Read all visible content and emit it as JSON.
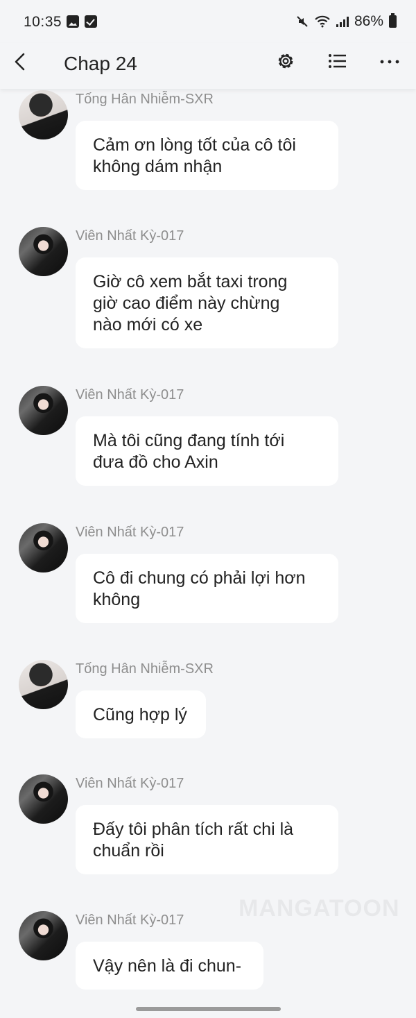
{
  "status_bar": {
    "time": "10:35",
    "battery": "86%",
    "icons": [
      "gallery-icon",
      "checkbox-icon",
      "mute-icon",
      "wifi-icon",
      "signal-icon",
      "battery-icon"
    ]
  },
  "header": {
    "title": "Chap 24",
    "icons": [
      "back-arrow-icon",
      "gear-icon",
      "list-icon",
      "more-icon"
    ]
  },
  "messages": [
    {
      "sender": "Tống Hân Nhiễm-SXR",
      "lines": [
        "Cảm ơn lòng tốt của cô tôi",
        "không dám nhận"
      ]
    },
    {
      "sender": "Viên Nhất Kỳ-017",
      "lines": [
        "Giờ cô xem bắt taxi trong",
        "giờ cao điểm này chừng",
        "nào mới có xe"
      ]
    },
    {
      "sender": "Viên Nhất Kỳ-017",
      "lines": [
        "Mà tôi cũng đang tính tới",
        "đưa đồ cho Axin"
      ]
    },
    {
      "sender": "Viên Nhất Kỳ-017",
      "lines": [
        "Cô đi chung có phải lợi hơn",
        "không"
      ]
    },
    {
      "sender": "Tống Hân Nhiễm-SXR",
      "lines": [
        "Cũng hợp lý"
      ]
    },
    {
      "sender": "Viên Nhất Kỳ-017",
      "lines": [
        "Đấy tôi phân tích rất chi là",
        "chuẩn rồi"
      ]
    },
    {
      "sender": "Viên Nhất Kỳ-017",
      "lines": [
        "Vậy nên là đi chun-"
      ]
    }
  ],
  "watermark": "MANGATOON",
  "colors": {
    "background": "#f4f5f7",
    "bubble": "#ffffff",
    "sender": "#8e8e8e",
    "text": "#222222"
  }
}
